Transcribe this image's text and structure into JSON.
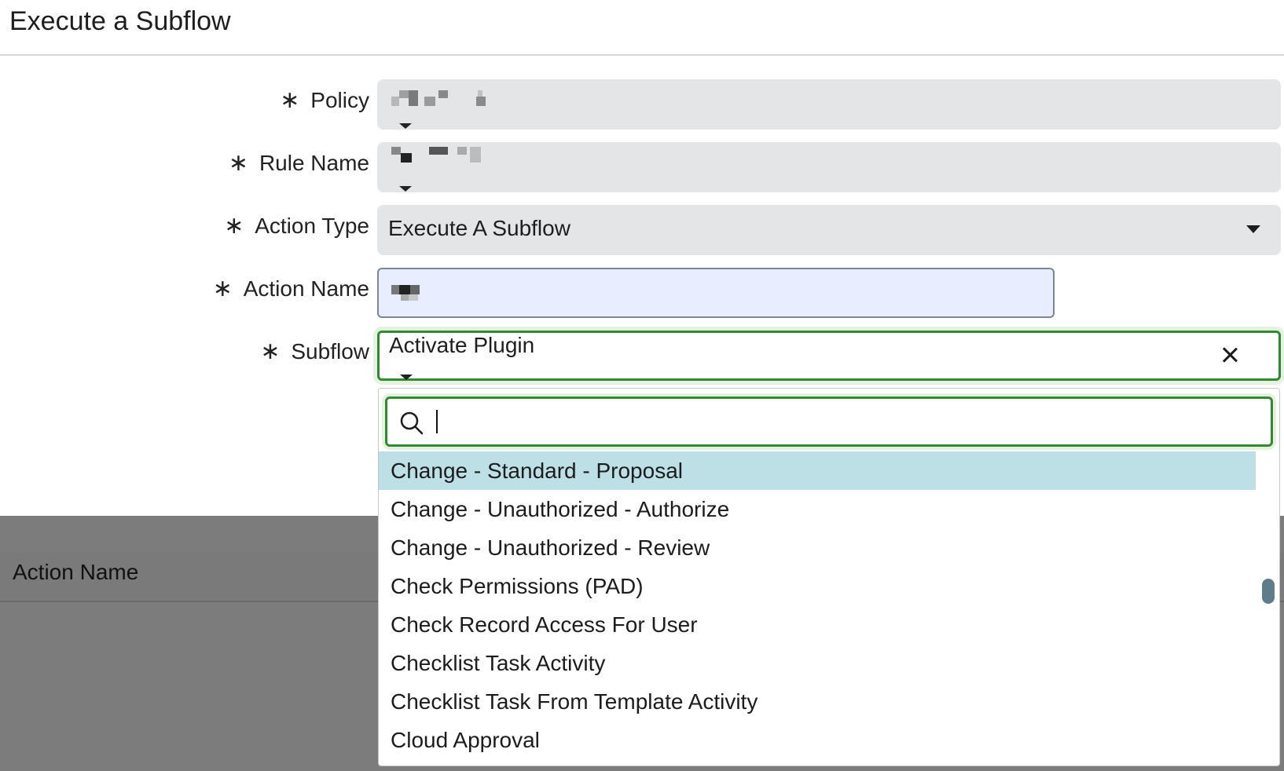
{
  "dialog": {
    "title": "Execute a Subflow"
  },
  "form": {
    "required_marker": "∗",
    "policy": {
      "label": "Policy",
      "value": ""
    },
    "rule_name": {
      "label": "Rule Name",
      "value": ""
    },
    "action_type": {
      "label": "Action Type",
      "value": "Execute A Subflow"
    },
    "action_name": {
      "label": "Action Name",
      "value": ""
    },
    "subflow": {
      "label": "Subflow",
      "value": "Activate Plugin"
    }
  },
  "dropdown": {
    "search_value": "",
    "options": [
      "Change - Standard - Proposal",
      "Change - Unauthorized - Authorize",
      "Change - Unauthorized - Review",
      "Check Permissions (PAD)",
      "Check Record Access For User",
      "Checklist Task Activity",
      "Checklist Task From Template Activity",
      "Cloud Approval"
    ],
    "highlighted_index": 0
  },
  "background_table": {
    "column_header": "Action Name"
  },
  "icons": {
    "required": "asterisk-icon",
    "dropdown": "caret-down-icon",
    "clear": "close-icon",
    "search": "search-icon"
  },
  "colors": {
    "focus_green": "#2e8b2e",
    "highlight": "#bddfe6",
    "field_gray": "#e4e5e7",
    "action_name_bg": "#e8eeff",
    "overlay": "#7c7c7c"
  }
}
